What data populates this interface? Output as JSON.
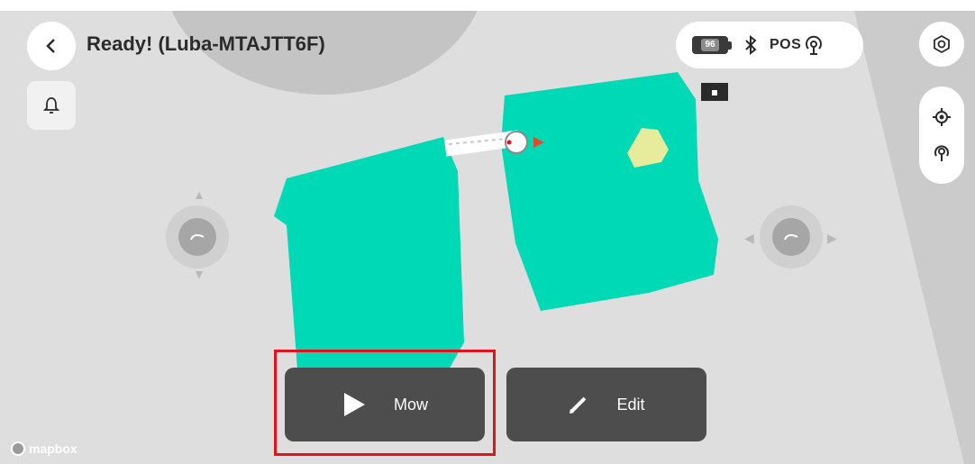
{
  "header": {
    "title": "Ready! (Luba-MTAJTT6F)"
  },
  "status": {
    "battery_level": "96",
    "position_label": "POS"
  },
  "actions": {
    "mow_label": "Mow",
    "edit_label": "Edit"
  },
  "map": {
    "attribution": "mapbox",
    "zone_color": "#00d9b6",
    "obstacle_color": "#e6ec9c"
  },
  "colors": {
    "highlight": "#e0141e",
    "button_bg": "#4d4d4d"
  },
  "icons": {
    "back": "chevron-left-icon",
    "bell": "bell-icon",
    "battery": "battery-icon",
    "bluetooth": "bluetooth-icon",
    "rtk": "rtk-signal-icon",
    "settings": "hexagon-settings-icon",
    "locate": "crosshair-icon",
    "rtk_station": "rtk-station-icon",
    "play": "play-icon",
    "pencil": "pencil-icon"
  }
}
